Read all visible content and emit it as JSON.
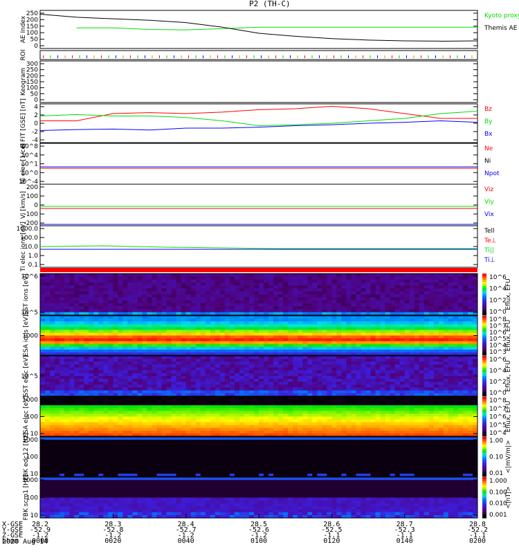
{
  "title": "P2 (TH-C)",
  "date": "2020 Aug 14",
  "colors": {
    "red": "#ff0000",
    "green": "#00dd00",
    "blue": "#0000ff",
    "black": "#000000"
  },
  "chart_data": [
    {
      "type": "line",
      "ylabel": "AE Index",
      "ylim": [
        0,
        250
      ],
      "yticks": [
        "250",
        "200",
        "150",
        "100",
        "50",
        "0"
      ],
      "x": [
        0,
        10,
        20,
        30,
        40,
        50,
        60,
        70,
        80,
        90,
        100,
        110,
        120
      ],
      "series": [
        {
          "name": "Kyoto proxy AE",
          "color": "#00dd00",
          "values": [
            null,
            135,
            135,
            125,
            122,
            130,
            140,
            140,
            140,
            140,
            140,
            140,
            140
          ]
        },
        {
          "name": "Themis AE",
          "color": "#000000",
          "values": [
            225,
            205,
            195,
            185,
            170,
            140,
            100,
            80,
            65,
            55,
            50,
            48,
            50
          ]
        }
      ]
    },
    {
      "type": "line",
      "ylabel": "ROI"
    },
    {
      "type": "heatmap",
      "ylabel": "Keogram",
      "ylim": [
        0,
        300
      ],
      "yticks": [
        "300",
        "250",
        "200",
        "150",
        "100",
        "50",
        "0"
      ]
    },
    {
      "type": "line",
      "ylabel": "B FIT [GSE] [nT]",
      "ylim": [
        -4,
        4
      ],
      "yticks": [
        "4",
        "2",
        "0",
        "-2",
        "-4"
      ],
      "x": [
        0,
        10,
        20,
        30,
        40,
        50,
        60,
        70,
        80,
        90,
        100,
        110,
        120
      ],
      "series": [
        {
          "name": "Bz",
          "color": "#ff0000",
          "values": [
            0.5,
            0.5,
            2.0,
            2.2,
            2.0,
            2.3,
            2.8,
            3.0,
            3.5,
            3.0,
            2.0,
            1.0,
            1.0
          ]
        },
        {
          "name": "By",
          "color": "#00dd00",
          "values": [
            1.5,
            1.8,
            1.5,
            1.5,
            1.2,
            0.5,
            -0.5,
            -0.3,
            0.0,
            0.5,
            1.0,
            2.0,
            2.5
          ]
        },
        {
          "name": "Bx",
          "color": "#0000ff",
          "values": [
            -1.5,
            -1.3,
            -1.2,
            -1.4,
            -1.0,
            -1.0,
            -0.8,
            -0.5,
            -0.3,
            0.0,
            0.2,
            0.5,
            0.2
          ]
        }
      ]
    },
    {
      "type": "line",
      "ylabel": "Ni elec [1/cc]",
      "yticks": [
        "10^8",
        "10^4",
        "10^1",
        "10^0",
        "10^-4"
      ],
      "series": [
        {
          "name": "Ne",
          "color": "#ff0000"
        },
        {
          "name": "Ni",
          "color": "#000000"
        },
        {
          "name": "Npot",
          "color": "#0000ff"
        }
      ]
    },
    {
      "type": "line",
      "ylabel": "Vi [km/s]",
      "ylim": [
        -300,
        300
      ],
      "yticks": [
        "200",
        "100",
        "0",
        "-100",
        "-200"
      ],
      "series": [
        {
          "name": "Viz",
          "color": "#ff0000",
          "value": -50
        },
        {
          "name": "Viy",
          "color": "#00dd00",
          "value": -20
        },
        {
          "name": "Vix",
          "color": "#0000ff",
          "value": -280
        }
      ]
    },
    {
      "type": "line",
      "ylabel": "Ti elec ions [eV]",
      "yticks": [
        "1000.0",
        "100.0",
        "10.0",
        "1.0",
        "0.1"
      ],
      "series": [
        {
          "name": "Tell",
          "color": "#000000"
        },
        {
          "name": "Te⊥",
          "color": "#ff0000"
        },
        {
          "name": "Ti||",
          "color": "#00dd00"
        },
        {
          "name": "Ti⊥",
          "color": "#0000ff"
        }
      ]
    },
    {
      "type": "heatmap",
      "ylabel": "SST ions [eV]",
      "yticks": [
        "10^6",
        "10^5"
      ],
      "colorbar": [
        "10^6",
        "10^4",
        "10^2",
        "10^0"
      ],
      "cbar_label": "Eflux, EFU"
    },
    {
      "type": "heatmap",
      "ylabel": "ESA ions [eV]",
      "yticks": [
        "1000"
      ],
      "colorbar": [
        "10^8",
        "10^7",
        "10^6",
        "10^5",
        "10^4",
        "10^3"
      ],
      "cbar_label": "Eflux, EFU"
    },
    {
      "type": "heatmap",
      "ylabel": "SST elec [eV]",
      "yticks": [
        "10^5"
      ],
      "colorbar": [
        "10^6",
        "10^4",
        "10^2",
        "10^0"
      ],
      "cbar_label": "Eflux, EFU"
    },
    {
      "type": "heatmap",
      "ylabel": "ESA elec [eV]",
      "yticks": [
        "1000",
        "100",
        "10"
      ],
      "colorbar": [
        "10^8",
        "10^7",
        "10^6",
        "10^5",
        "10^4"
      ],
      "cbar_label": "Eflux, EFU"
    },
    {
      "type": "heatmap",
      "ylabel": "FBK edc12 [Hz]",
      "yticks": [
        "1000",
        "100",
        "10"
      ],
      "colorbar": [
        "1.00",
        "0.10",
        "0.01"
      ],
      "cbar_label": "<|mV/m|>"
    },
    {
      "type": "heatmap",
      "ylabel": "FBK scm1 [Hz]",
      "yticks": [
        "1000",
        "100",
        "10"
      ],
      "colorbar": [
        "1.000",
        "0.100",
        "0.010",
        "0.001"
      ],
      "cbar_label": "<|nT|>"
    }
  ],
  "xaxis": {
    "rows": [
      "X-GSE",
      "Y-GSE",
      "Z-GSE",
      "hhmm"
    ],
    "ticks": [
      [
        "28.2",
        "-52.9",
        "-1.2",
        "0000"
      ],
      [
        "28.3",
        "-52.8",
        "-1.2",
        "0020"
      ],
      [
        "28.4",
        "-52.7",
        "-1.2",
        "0040"
      ],
      [
        "28.5",
        "-52.6",
        "-1.2",
        "0100"
      ],
      [
        "28.6",
        "-52.5",
        "-1.1",
        "0120"
      ],
      [
        "28.7",
        "-52.3",
        "-1.1",
        "0140"
      ],
      [
        "28.8",
        "-52.2",
        "-1.1",
        "0200"
      ]
    ]
  }
}
